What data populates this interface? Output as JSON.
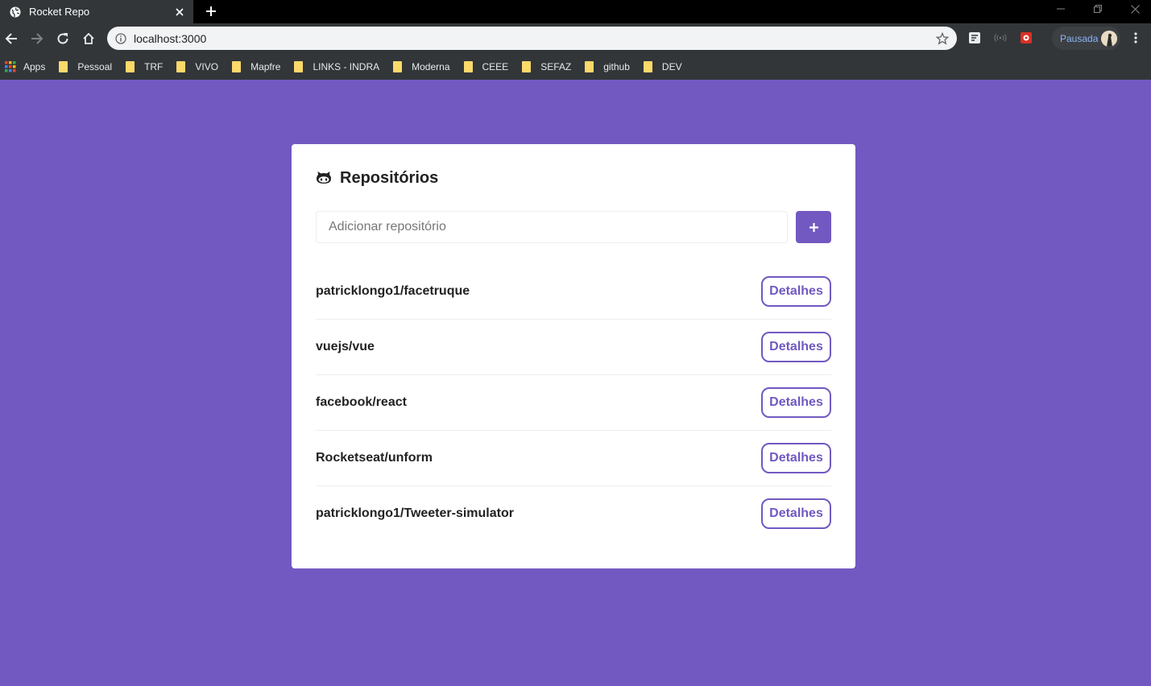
{
  "browser": {
    "tab_title": "Rocket Repo",
    "url": "localhost:3000",
    "profile_name": "Pausada",
    "bookmarks": [
      "Apps",
      "Pessoal",
      "TRF",
      "VIVO",
      "Mapfre",
      "LINKS - INDRA",
      "Moderna",
      "CEEE",
      "SEFAZ",
      "github",
      "DEV"
    ]
  },
  "page": {
    "title": "Repositórios",
    "input_placeholder": "Adicionar repositório",
    "add_button_icon": "plus-icon",
    "details_label": "Detalhes",
    "repositories": [
      "patricklongo1/facetruque",
      "vuejs/vue",
      "facebook/react",
      "Rocketseat/unform",
      "patricklongo1/Tweeter-simulator"
    ]
  },
  "colors": {
    "background": "#7159c1",
    "accent": "#7159c1",
    "card": "#ffffff"
  }
}
